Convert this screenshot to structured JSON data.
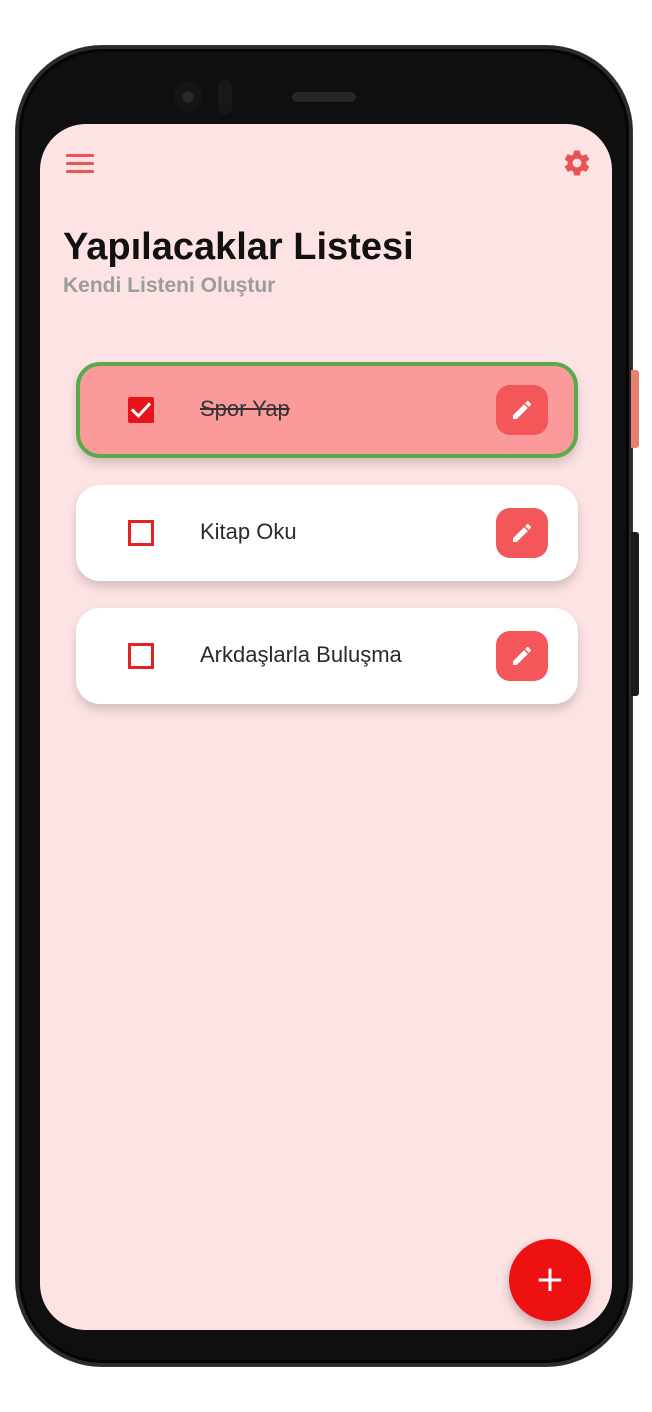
{
  "app": {
    "title": "Yapılacaklar Listesi",
    "subtitle": "Kendi Listeni Oluştur"
  },
  "toolbar": {
    "menu_icon": "menu-icon",
    "settings_icon": "gear-icon"
  },
  "tasks": [
    {
      "label": "Spor Yap",
      "completed": true
    },
    {
      "label": "Kitap Oku",
      "completed": false
    },
    {
      "label": "Arkdaşlarla Buluşma",
      "completed": false
    }
  ],
  "fab": {
    "label": "+",
    "icon": "plus-icon"
  },
  "colors": {
    "background": "#fde3e4",
    "accent": "#f3575a",
    "completed_card": "#fb9a9a",
    "completed_border": "#5aaa4b",
    "checkbox": "#e02424",
    "fab": "#ee1111"
  }
}
